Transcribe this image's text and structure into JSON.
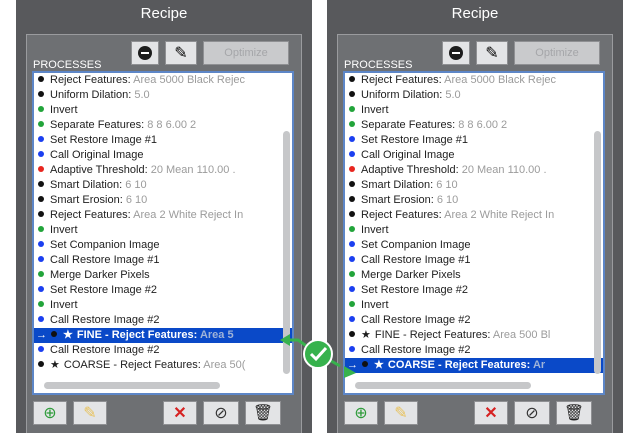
{
  "colors": {
    "green": "#22a43a",
    "blue": "#1b3ff0",
    "red": "#e8261f",
    "black": "#111111",
    "selection": "#0a49c8",
    "check": "#37b24d"
  },
  "left": {
    "title": "Recipe",
    "processes_label": "PROCESSES",
    "optimize_label": "Optimize",
    "items": [
      {
        "dot": "black",
        "name": "Reject Features:",
        "params": "Area 5000 Black Rejec"
      },
      {
        "dot": "black",
        "name": "Uniform Dilation:",
        "params": "5.0"
      },
      {
        "dot": "green",
        "name": "Invert",
        "params": ""
      },
      {
        "dot": "green",
        "name": "Separate Features:",
        "params": "8 8 6.00 2"
      },
      {
        "dot": "blue",
        "name": "Set Restore Image #1",
        "params": ""
      },
      {
        "dot": "blue",
        "name": "Call Original Image",
        "params": ""
      },
      {
        "dot": "red",
        "name": "Adaptive Threshold:",
        "params": "20 Mean 110.00 ."
      },
      {
        "dot": "black",
        "name": "Smart Dilation:",
        "params": "6 10"
      },
      {
        "dot": "black",
        "name": "Smart Erosion:",
        "params": "6 10"
      },
      {
        "dot": "black",
        "name": "Reject Features:",
        "params": "Area 2 White Reject In"
      },
      {
        "dot": "green",
        "name": "Invert",
        "params": ""
      },
      {
        "dot": "blue",
        "name": "Set Companion Image",
        "params": ""
      },
      {
        "dot": "blue",
        "name": "Call Restore Image #1",
        "params": ""
      },
      {
        "dot": "green",
        "name": "Merge Darker Pixels",
        "params": ""
      },
      {
        "dot": "blue",
        "name": "Set Restore Image #2",
        "params": ""
      },
      {
        "dot": "green",
        "name": "Invert",
        "params": ""
      },
      {
        "dot": "blue",
        "name": "Call Restore Image #2",
        "params": ""
      },
      {
        "dot": "black",
        "selected": true,
        "arrow": "→",
        "star": "★",
        "name": "FINE - Reject Features:",
        "params": "Area 5"
      },
      {
        "dot": "blue",
        "name": "Call Restore Image #2",
        "params": ""
      },
      {
        "dot": "black",
        "star": "★",
        "name": "COARSE - Reject Features:",
        "params": "Area 50("
      }
    ]
  },
  "right": {
    "title": "Recipe",
    "processes_label": "PROCESSES",
    "optimize_label": "Optimize",
    "items": [
      {
        "dot": "black",
        "name": "Reject Features:",
        "params": "Area 5000 Black Rejec"
      },
      {
        "dot": "black",
        "name": "Uniform Dilation:",
        "params": "5.0"
      },
      {
        "dot": "green",
        "name": "Invert",
        "params": ""
      },
      {
        "dot": "green",
        "name": "Separate Features:",
        "params": "8 8 6.00 2"
      },
      {
        "dot": "blue",
        "name": "Set Restore Image #1",
        "params": ""
      },
      {
        "dot": "blue",
        "name": "Call Original Image",
        "params": ""
      },
      {
        "dot": "red",
        "name": "Adaptive Threshold:",
        "params": "20 Mean 110.00 ."
      },
      {
        "dot": "black",
        "name": "Smart Dilation:",
        "params": "6 10"
      },
      {
        "dot": "black",
        "name": "Smart Erosion:",
        "params": "6 10"
      },
      {
        "dot": "black",
        "name": "Reject Features:",
        "params": "Area 2 White Reject In"
      },
      {
        "dot": "green",
        "name": "Invert",
        "params": ""
      },
      {
        "dot": "blue",
        "name": "Set Companion Image",
        "params": ""
      },
      {
        "dot": "blue",
        "name": "Call Restore Image #1",
        "params": ""
      },
      {
        "dot": "green",
        "name": "Merge Darker Pixels",
        "params": ""
      },
      {
        "dot": "blue",
        "name": "Set Restore Image #2",
        "params": ""
      },
      {
        "dot": "green",
        "name": "Invert",
        "params": ""
      },
      {
        "dot": "blue",
        "name": "Call Restore Image #2",
        "params": ""
      },
      {
        "dot": "black",
        "star": "★",
        "name": "FINE - Reject Features:",
        "params": "Area 500 Bl"
      },
      {
        "dot": "blue",
        "name": "Call Restore Image #2",
        "params": ""
      },
      {
        "dot": "black",
        "selected": true,
        "arrow": "→",
        "star": "★",
        "name": "COARSE - Reject Features:",
        "params": "Ar"
      }
    ]
  },
  "icons": {
    "minus": "minus-circle-icon",
    "pencil": "pencil-icon",
    "add": "add-circle-icon",
    "edit": "edit-pencil-icon",
    "delete": "delete-x-icon",
    "cancel": "cancel-circle-icon",
    "trash": "trash-icon",
    "check": "checkmark-icon",
    "arrow": "arrow-right-icon",
    "star": "star-icon"
  }
}
